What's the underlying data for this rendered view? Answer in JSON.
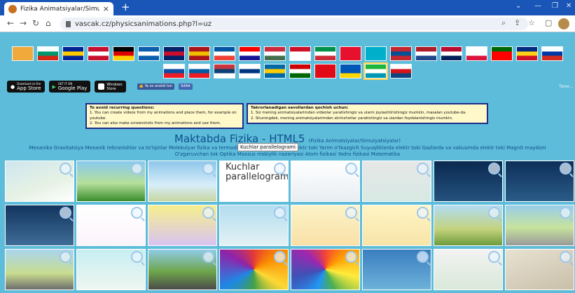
{
  "browser": {
    "tab_title": "Fizika Animatsiyalar/Simulyatsiya",
    "tab_close": "×",
    "new_tab": "+",
    "url": "vascak.cz/physicsanimations.php?l=uz",
    "icons": [
      "back-icon",
      "forward-icon",
      "reload-icon",
      "home-icon",
      "lock-icon",
      "zoom-icon",
      "share-icon",
      "star-icon",
      "sidebar-icon",
      "profile-icon"
    ]
  },
  "flags": [
    {
      "name": "…",
      "colors": [
        "#f2a93b",
        "#f2a93b",
        "#f2a93b"
      ]
    },
    {
      "name": "bulgaria",
      "colors": [
        "#ffffff",
        "#00966e",
        "#d62612"
      ]
    },
    {
      "name": "bosnia",
      "colors": [
        "#002395",
        "#fecb00",
        "#002395"
      ]
    },
    {
      "name": "denmark",
      "colors": [
        "#c8102e",
        "#ffffff",
        "#c8102e"
      ]
    },
    {
      "name": "germany",
      "colors": [
        "#000000",
        "#dd0000",
        "#ffce00"
      ]
    },
    {
      "name": "greece",
      "colors": [
        "#0d5eaf",
        "#ffffff",
        "#0d5eaf"
      ]
    },
    {
      "name": "uk",
      "colors": [
        "#012169",
        "#c8102e",
        "#012169"
      ]
    },
    {
      "name": "spain",
      "colors": [
        "#aa151b",
        "#f1bf00",
        "#aa151b"
      ]
    },
    {
      "name": "france",
      "colors": [
        "#0055a4",
        "#ffffff",
        "#ef4135"
      ]
    },
    {
      "name": "croatia",
      "colors": [
        "#ff0000",
        "#ffffff",
        "#171796"
      ]
    },
    {
      "name": "hungary",
      "colors": [
        "#cd2a3e",
        "#ffffff",
        "#436f4d"
      ]
    },
    {
      "name": "indonesia",
      "colors": [
        "#ce1126",
        "#ffffff",
        "#ffffff"
      ]
    },
    {
      "name": "italy",
      "colors": [
        "#009246",
        "#ffffff",
        "#ce2b37"
      ]
    },
    {
      "name": "kyrgyzstan",
      "colors": [
        "#e8112d",
        "#e8112d",
        "#e8112d"
      ]
    },
    {
      "name": "kazakhstan",
      "colors": [
        "#00afca",
        "#00afca",
        "#00afca"
      ]
    },
    {
      "name": "mongolia",
      "colors": [
        "#c4272f",
        "#015197",
        "#c4272f"
      ]
    },
    {
      "name": "netherlands",
      "colors": [
        "#ae1c28",
        "#ffffff",
        "#21468b"
      ]
    },
    {
      "name": "norway",
      "colors": [
        "#ba0c2f",
        "#ffffff",
        "#00205b"
      ]
    },
    {
      "name": "poland",
      "colors": [
        "#ffffff",
        "#ffffff",
        "#dc143c"
      ]
    },
    {
      "name": "portugal",
      "colors": [
        "#006600",
        "#ff0000",
        "#ff0000"
      ]
    },
    {
      "name": "romania",
      "colors": [
        "#002b7f",
        "#fcd116",
        "#ce1126"
      ]
    },
    {
      "name": "russia",
      "colors": [
        "#ffffff",
        "#0039a6",
        "#d52b1e"
      ]
    },
    {
      "name": "slovakia",
      "colors": [
        "#ffffff",
        "#0b4ea2",
        "#ee1c25"
      ]
    },
    {
      "name": "slovenia",
      "colors": [
        "#ffffff",
        "#005da4",
        "#ed1c24"
      ]
    },
    {
      "name": "serbia",
      "colors": [
        "#c6363c",
        "#0c4076",
        "#ffffff"
      ]
    },
    {
      "name": "finland",
      "colors": [
        "#ffffff",
        "#003580",
        "#ffffff"
      ]
    },
    {
      "name": "sweden",
      "colors": [
        "#006aa7",
        "#fecc00",
        "#006aa7"
      ]
    },
    {
      "name": "tajikistan",
      "colors": [
        "#cc0000",
        "#ffffff",
        "#006600"
      ]
    },
    {
      "name": "turkey",
      "colors": [
        "#e30a17",
        "#e30a17",
        "#e30a17"
      ]
    },
    {
      "name": "ukraine",
      "colors": [
        "#0057b7",
        "#0057b7",
        "#ffd700"
      ]
    },
    {
      "name": "uzbekistan",
      "colors": [
        "#1eb53a",
        "#ffffff",
        "#0099b5"
      ]
    },
    {
      "name": "czechia",
      "colors": [
        "#ffffff",
        "#d7141a",
        "#11457e"
      ]
    }
  ],
  "stores": {
    "appstore_top": "Download on the",
    "appstore": "App Store",
    "googleplay_top": "GET IT ON",
    "googleplay": "Google Play",
    "windows_top": "Windows",
    "windows": "Store",
    "fb_like": "👍 Ya se arašdi ton",
    "fb_share": "Sdílet",
    "right_tag": "Twee…"
  },
  "notice_en": {
    "title": "To avoid recurring questions:",
    "line1": "1. You can create videos from my animations and place them, for example on youtube.",
    "line2": "2. You can also make screenshots from my animations and use them."
  },
  "notice_uz": {
    "title": "Takrorlanadigan savollardan qochish uchun:",
    "line1": "1. Siz mening animatsiyalarimdan videolar yaratishingiz va ularni joylashtirishingiz mumkin, masalan youtube-da.",
    "line2": "2. Shuningdek, mening animatsiyalarimdan skrinshotlar yaratishingiz va ulardan foydalanishingiz mumkin."
  },
  "heading": {
    "title": "Maktabda Fizika - HTML5",
    "subtitle": "(Fizika Animatsiyalar/Simulyatsiyalar)"
  },
  "subjects": "Mexanika Gravitatsiya Mexanik tebranishlar va to'lqinlar Molekulyar fizika va termodinamika Elektrostatika Elektr toki Yarim o'tkazgich Suyuqliklarda elektr toki Gazlarda va vakuumda elektr toki Magnit maydoni O'zgaruvchan tok Optika Maxsus nisbiylik nazariyasi Atom fizikasi Yadro fizikasi Matematika",
  "thumbnails": [
    {
      "name": "thumb-1",
      "bg": "linear-gradient(160deg,#cfe6ef 0%,#e6f2e4 60%,#ffffff 100%)",
      "caption": ""
    },
    {
      "name": "thumb-2",
      "bg": "linear-gradient(180deg,#89c9ee 0%,#b6e09b 55%,#3a8c2d 100%)",
      "caption": ""
    },
    {
      "name": "thumb-3",
      "bg": "linear-gradient(180deg,#8ec6ea 0%,#d8eef9 60%,#c6d6a0 100%)",
      "caption": ""
    },
    {
      "name": "thumb-4",
      "bg": "linear-gradient(180deg,#ffffff 0%,#ffffff 100%)",
      "caption": "Kuchlar parallelogrami"
    },
    {
      "name": "thumb-5",
      "bg": "linear-gradient(180deg,#ffffff 0%,#e9eef2 100%)",
      "caption": ""
    },
    {
      "name": "thumb-6",
      "bg": "linear-gradient(180deg,#e7e7e7 0%,#d7e9e4 100%)",
      "caption": ""
    },
    {
      "name": "thumb-7",
      "bg": "linear-gradient(180deg,#0a2950 0%,#24527e 100%)",
      "caption": ""
    },
    {
      "name": "thumb-8",
      "bg": "linear-gradient(180deg,#0d2f59 0%,#2a5c88 100%)",
      "caption": ""
    },
    {
      "name": "thumb-9",
      "bg": "linear-gradient(180deg,#12345f 0%,#3f6d97 100%)",
      "caption": ""
    },
    {
      "name": "thumb-10",
      "bg": "linear-gradient(180deg,#ffffff 0%,#fbf4fb 100%)",
      "caption": ""
    },
    {
      "name": "thumb-11",
      "bg": "linear-gradient(180deg,#f6ef8d 0%,#d8c3f2 100%)",
      "caption": ""
    },
    {
      "name": "thumb-12",
      "bg": "linear-gradient(180deg,#b2ddf0 0%,#e4f2f4 100%)",
      "caption": ""
    },
    {
      "name": "thumb-13",
      "bg": "linear-gradient(180deg,#fbf3c8 0%,#fae0a6 100%)",
      "caption": ""
    },
    {
      "name": "thumb-14",
      "bg": "linear-gradient(180deg,#fff5c5 0%,#f7e4a8 100%)",
      "caption": ""
    },
    {
      "name": "thumb-15",
      "bg": "linear-gradient(180deg,#b1ddf3 0%,#c4d27d 60%,#6d9b3c 100%)",
      "caption": ""
    },
    {
      "name": "thumb-16",
      "bg": "linear-gradient(180deg,#98cdea 0%,#c7e39d 55%,#9a9a9a 100%)",
      "caption": ""
    },
    {
      "name": "thumb-17",
      "bg": "linear-gradient(180deg,#a9d5ef 0%,#c8dc8f 60%,#6d6d6d 100%)",
      "caption": ""
    },
    {
      "name": "thumb-18",
      "bg": "linear-gradient(180deg,#c7eef2 0%,#eef6f0 100%)",
      "caption": ""
    },
    {
      "name": "thumb-19",
      "bg": "linear-gradient(180deg,#8fcce9 0%,#6ea54a 55%,#4a4a4a 100%)",
      "caption": ""
    },
    {
      "name": "thumb-20",
      "bg": "conic-gradient(#e53935,#fb8c00,#fdd835,#43a047,#1e88e5,#8e24aa,#e53935)",
      "caption": ""
    },
    {
      "name": "thumb-21",
      "bg": "conic-gradient(#f44336,#ff9800,#ffeb3b,#4caf50,#2196f3,#3f51b5,#9c27b0,#f44336)",
      "caption": ""
    },
    {
      "name": "thumb-22",
      "bg": "linear-gradient(180deg,#3a7ec0 0%,#6db2d9 100%)",
      "caption": ""
    },
    {
      "name": "thumb-23",
      "bg": "linear-gradient(180deg,#f2f2f2 0%,#d9e9d9 100%)",
      "caption": ""
    },
    {
      "name": "thumb-24",
      "bg": "linear-gradient(160deg,#e8e2d2 0%,#c9bfa9 100%)",
      "caption": ""
    }
  ],
  "tooltip": "Kuchlar parallelogrami"
}
